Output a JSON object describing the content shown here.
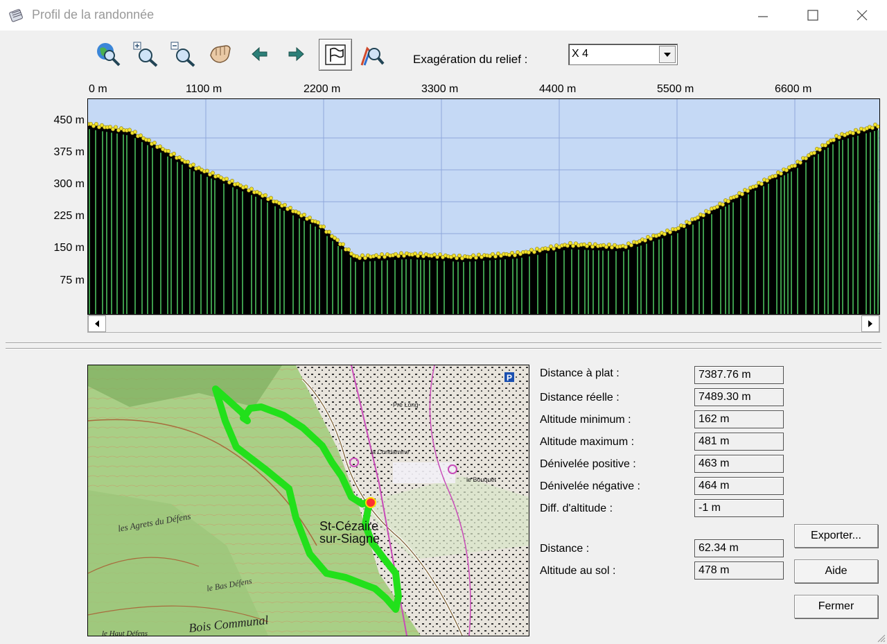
{
  "window": {
    "title": "Profil de la randonnée"
  },
  "toolbar": {
    "tools": [
      {
        "icon": "globe-zoom-icon"
      },
      {
        "icon": "zoom-in-icon"
      },
      {
        "icon": "zoom-out-icon"
      },
      {
        "icon": "pan-hand-icon"
      },
      {
        "icon": "arrow-left-icon"
      },
      {
        "icon": "arrow-right-icon"
      },
      {
        "icon": "flag-icon",
        "active": true
      },
      {
        "icon": "walker-zoom-icon"
      }
    ],
    "exaggeration_label": "Exagération du relief :",
    "exaggeration_value": "X 4"
  },
  "chart_data": {
    "type": "area",
    "x_ticks": [
      "0 m",
      "1100 m",
      "2200 m",
      "3300 m",
      "4400 m",
      "5500 m",
      "6600 m"
    ],
    "y_ticks": [
      "450 m",
      "375 m",
      "300 m",
      "225 m",
      "150 m",
      "75 m"
    ],
    "xlim": [
      0,
      7387.76
    ],
    "ylim": [
      0,
      500
    ],
    "grid": true,
    "x": [
      0,
      400,
      1000,
      1600,
      2150,
      2500,
      3000,
      3500,
      4000,
      4500,
      5000,
      5500,
      6000,
      6600,
      7000,
      7387
    ],
    "y": [
      481,
      465,
      380,
      318,
      248,
      168,
      175,
      168,
      176,
      198,
      193,
      235,
      305,
      385,
      452,
      479
    ],
    "colors": {
      "sky": "#c5d9f5",
      "ground": "#000000",
      "stripes": "#3d9a4b",
      "points": "#f0e12e",
      "grid": "#8fa8dc"
    }
  },
  "map": {
    "labels": [
      "St-Cézaire",
      "sur-Siagne",
      "les Agrets du Défens",
      "le Bas Défens",
      "Bois Communal",
      "le Haut Défens",
      "la Condamine",
      "Pré Long",
      "le Bouquet",
      "P"
    ],
    "route_color": "#22e01b"
  },
  "stats": [
    {
      "label": "Distance à plat :",
      "value": "7387.76 m"
    },
    {
      "label": "Distance réelle :",
      "value": "7489.30 m"
    },
    {
      "label": "Altitude minimum :",
      "value": "162 m"
    },
    {
      "label": "Altitude maximum :",
      "value": "481 m"
    },
    {
      "label": "Dénivelée positive :",
      "value": "463 m"
    },
    {
      "label": "Dénivelée négative :",
      "value": "464 m"
    },
    {
      "label": "Diff. d'altitude :",
      "value": "-1 m"
    }
  ],
  "cursor": [
    {
      "label": "Distance :",
      "value": "62.34 m"
    },
    {
      "label": "Altitude au sol :",
      "value": "478 m"
    }
  ],
  "buttons": {
    "export": "Exporter...",
    "help": "Aide",
    "close": "Fermer"
  }
}
